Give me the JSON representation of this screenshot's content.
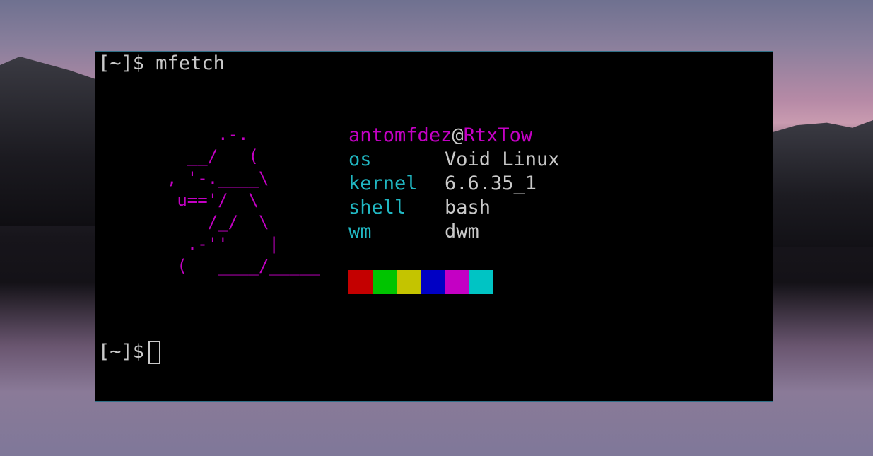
{
  "terminal": {
    "prompt": "[~]$",
    "command": "mfetch",
    "cursor_prompt": "[~]$"
  },
  "ascii_art": "       .-.\n    __/   (\n  , '-.____\\\n   u=='/  \\\n      /_/  \\\n    .-''    |\n   (   ____/_____",
  "info": {
    "user": "antomfdez",
    "at": "@",
    "host": "RtxTow",
    "rows": [
      {
        "key": "os",
        "value": "Void Linux"
      },
      {
        "key": "kernel",
        "value": "6.6.35_1"
      },
      {
        "key": "shell",
        "value": "bash"
      },
      {
        "key": "wm",
        "value": "dwm"
      }
    ]
  },
  "palette": [
    "#c40000",
    "#00c400",
    "#c4c400",
    "#0000c4",
    "#c400c4",
    "#00c4c4"
  ],
  "colors": {
    "accent_magenta": "#c400c4",
    "accent_cyan": "#21b8c3",
    "text": "#c9c9c9",
    "terminal_bg": "#000000",
    "border": "#2f6f86"
  }
}
